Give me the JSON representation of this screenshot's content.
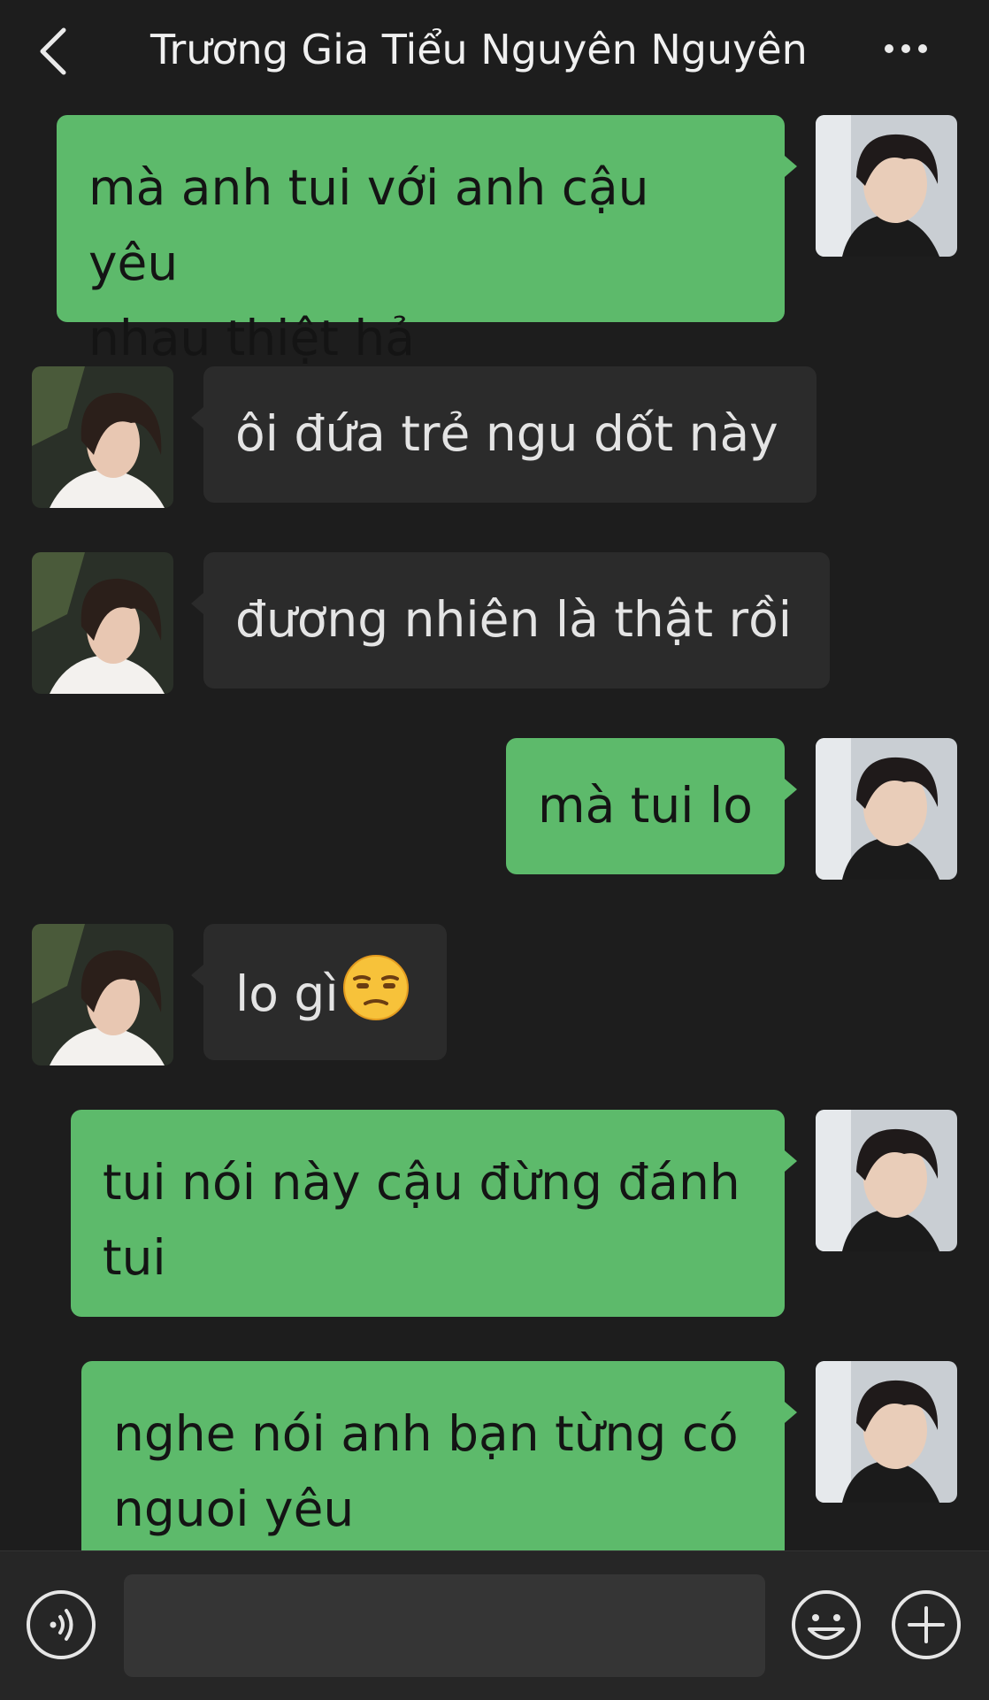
{
  "header": {
    "title": "Trương Gia Tiểu Nguyên Nguyên",
    "back_icon": "chevron-left-icon",
    "more_icon": "more-horizontal-icon"
  },
  "colors": {
    "background": "#1d1d1d",
    "outgoing_bubble": "#5dba6b",
    "incoming_bubble": "#2b2b2b",
    "input_bar": "#262626"
  },
  "messages": [
    {
      "direction": "outgoing",
      "line1": "mà anh tui với anh cậu yêu",
      "line2": "nhau thiệt hả"
    },
    {
      "direction": "incoming",
      "text": "ôi đứa trẻ ngu dốt này"
    },
    {
      "direction": "incoming",
      "text": "đương nhiên là thật rồi"
    },
    {
      "direction": "outgoing",
      "text": "mà tui lo"
    },
    {
      "direction": "incoming",
      "text": "lo gì",
      "emoji": "unamused-face-emoji"
    },
    {
      "direction": "outgoing",
      "line1": "tui nói này cậu đừng đánh",
      "line2": "tui"
    },
    {
      "direction": "outgoing",
      "line1": "nghe nói anh bạn từng có",
      "line2": "nguoi yêu"
    }
  ],
  "input_bar": {
    "voice_icon": "voice-icon",
    "emoji_icon": "emoji-icon",
    "plus_icon": "plus-icon"
  }
}
